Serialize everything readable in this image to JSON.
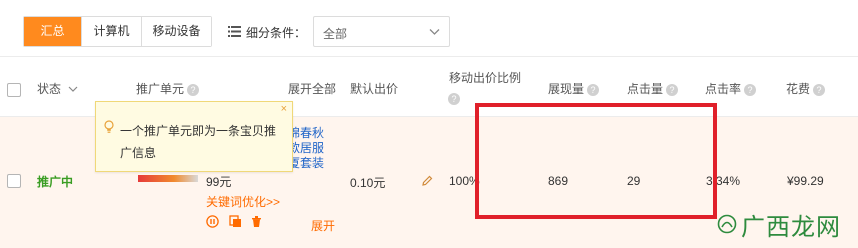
{
  "tabs": [
    {
      "label": "汇总",
      "active": true
    },
    {
      "label": "计算机",
      "active": false
    },
    {
      "label": "移动设备",
      "active": false
    }
  ],
  "filter": {
    "label": "细分条件：",
    "value": "全部"
  },
  "columns": {
    "status": "状态",
    "unit": "推广单元",
    "expand_all": "展开全部",
    "default_bid": "默认出价",
    "mobile_bid_line1": "移动出价比例",
    "impressions": "展现量",
    "clicks": "点击量",
    "ctr": "点击率",
    "cost": "花费"
  },
  "tooltip": {
    "text": "一个推广单元即为一条宝贝推广信息",
    "close": "×"
  },
  "row": {
    "status": "推广中",
    "title_line1": "棉春秋",
    "title_line2": "款居服",
    "title_line3": "厦套装",
    "price": "99元",
    "keyword_opt": "关键词优化>>",
    "expand": "展开",
    "default_bid": "0.10元",
    "mobile_ratio": "100%",
    "impressions": "869",
    "clicks": "29",
    "ctr": "3.34%",
    "cost": "¥99.29"
  },
  "watermark": "广西龙网",
  "colors": {
    "accent": "#ff8a1e",
    "highlight": "#e0202a",
    "status_green": "#3a9d23"
  }
}
